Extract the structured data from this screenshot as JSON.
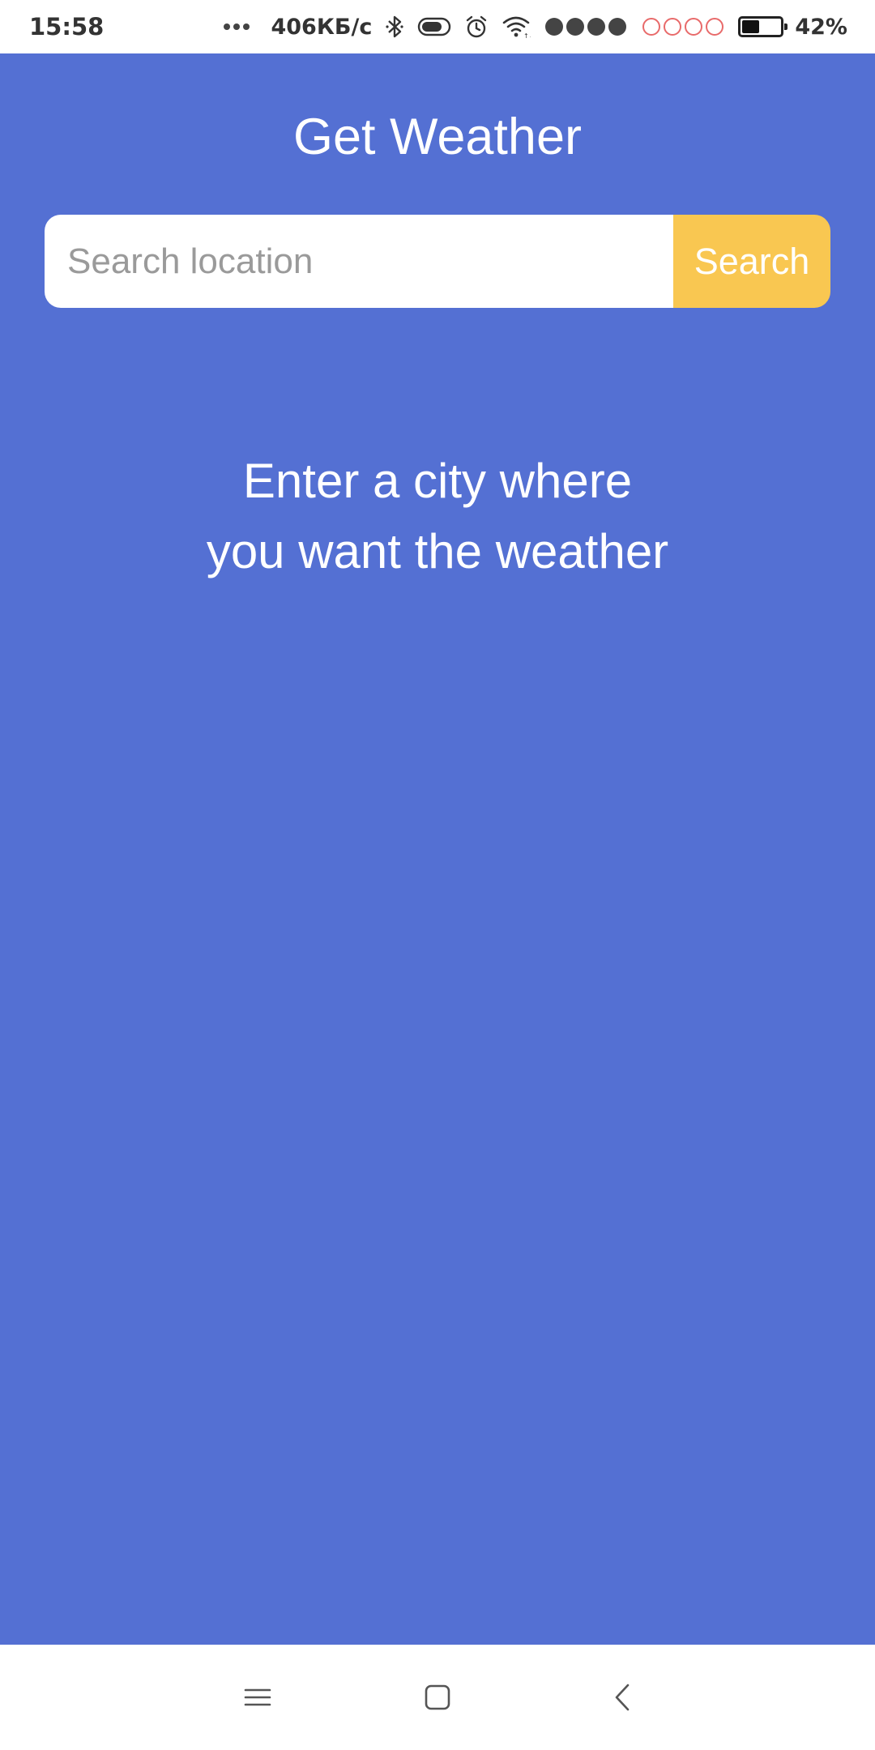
{
  "status_bar": {
    "time": "15:58",
    "network_speed": "406КБ/с",
    "battery_percent": "42%",
    "battery_level": 0.42,
    "icons": [
      "more-dots-icon",
      "bluetooth-icon",
      "toggle-icon",
      "alarm-icon",
      "wifi-icon",
      "signal-sim1-icon",
      "signal-sim2-icon",
      "battery-icon"
    ]
  },
  "header": {
    "title": "Get Weather"
  },
  "search": {
    "placeholder": "Search location",
    "value": "",
    "button_label": "Search"
  },
  "prompt": {
    "line1": "Enter a city where",
    "line2": "you want the weather"
  },
  "nav_bar": {
    "icons": [
      "menu-icon",
      "home-icon",
      "back-icon"
    ]
  },
  "colors": {
    "background": "#5470d3",
    "accent": "#f9c751",
    "text_on_bg": "#ffffff"
  }
}
